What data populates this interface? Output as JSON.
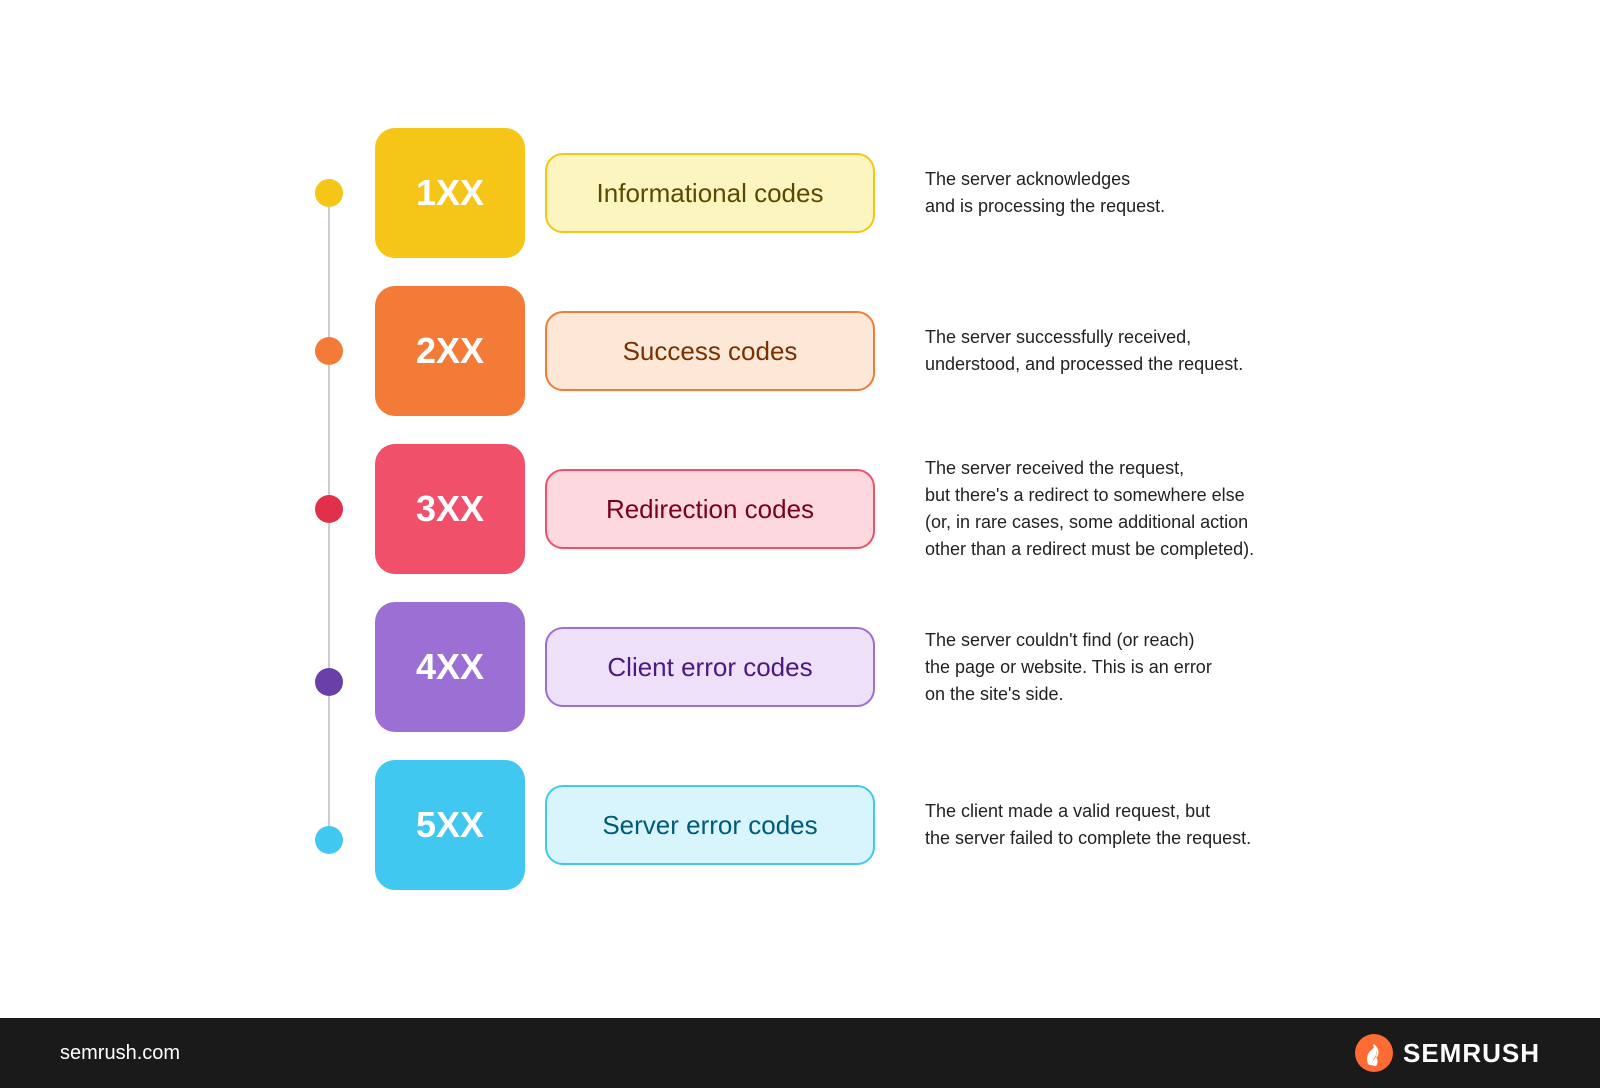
{
  "rows": [
    {
      "id": "1xx",
      "code": "1XX",
      "label": "Informational codes",
      "description": "The server acknowledges\nand is processing the request.",
      "dotColor": "#f5c518",
      "codeBoxBg": "#f5c518",
      "labelBoxBg": "#fdf5c0",
      "labelBoxBorder": "#f5c518",
      "labelTextColor": "#5a4a00"
    },
    {
      "id": "2xx",
      "code": "2XX",
      "label": "Success codes",
      "description": "The server successfully received,\nunderstood, and processed the request.",
      "dotColor": "#f47a38",
      "codeBoxBg": "#f47a38",
      "labelBoxBg": "#fde8d8",
      "labelBoxBorder": "#f47a38",
      "labelTextColor": "#7a3000"
    },
    {
      "id": "3xx",
      "code": "3XX",
      "label": "Redirection codes",
      "description": "The server received the request,\nbut there's a redirect to somewhere else\n(or, in rare cases, some additional action\nother than a redirect must be completed).",
      "dotColor": "#e0304a",
      "codeBoxBg": "#f0506a",
      "labelBoxBg": "#fdd8df",
      "labelBoxBorder": "#f0506a",
      "labelTextColor": "#7a0020"
    },
    {
      "id": "4xx",
      "code": "4XX",
      "label": "Client error codes",
      "description": "The server couldn't find (or reach)\nthe page or website. This is an error\non the site's side.",
      "dotColor": "#6a3fa8",
      "codeBoxBg": "#9b6fd4",
      "labelBoxBg": "#ede0f8",
      "labelBoxBorder": "#9b6fd4",
      "labelTextColor": "#4a1a80"
    },
    {
      "id": "5xx",
      "code": "5XX",
      "label": "Server error codes",
      "description": "The client made a valid request, but\nthe server failed to complete the request.",
      "dotColor": "#40c8f0",
      "codeBoxBg": "#40c8f0",
      "labelBoxBg": "#d8f5fd",
      "labelBoxBorder": "#40c8f0",
      "labelTextColor": "#005a7a"
    }
  ],
  "footer": {
    "url": "semrush.com",
    "brand": "SEMRUSH"
  }
}
